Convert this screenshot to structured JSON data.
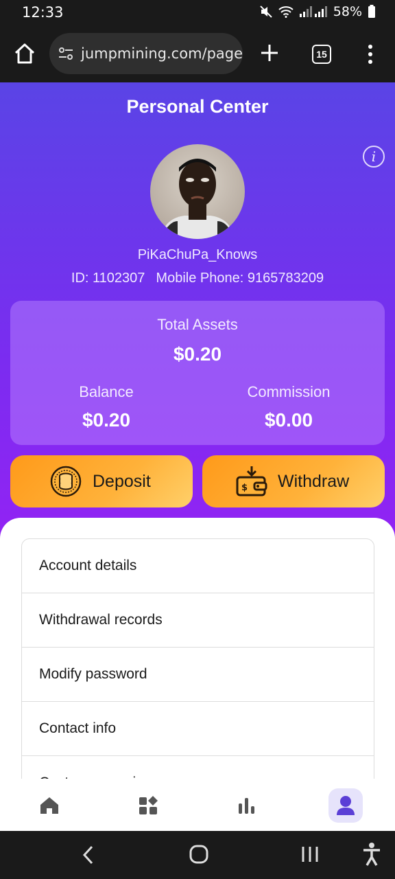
{
  "status": {
    "time": "12:33",
    "battery": "58%"
  },
  "browser": {
    "url": "jumpmining.com/pages",
    "tab_count": "15"
  },
  "page": {
    "title": "Personal Center"
  },
  "user": {
    "name": "PiKaChuPa_Knows",
    "id_text": "ID: 1102307",
    "phone_text": "Mobile Phone: 9165783209"
  },
  "assets": {
    "total_label": "Total Assets",
    "total_value": "$0.20",
    "balance_label": "Balance",
    "balance_value": "$0.20",
    "commission_label": "Commission",
    "commission_value": "$0.00"
  },
  "actions": {
    "deposit_label": "Deposit",
    "withdraw_label": "Withdraw"
  },
  "menu": {
    "items": [
      {
        "label": "Account details"
      },
      {
        "label": "Withdrawal records"
      },
      {
        "label": "Modify password"
      },
      {
        "label": "Contact info"
      },
      {
        "label": "Customer service"
      }
    ]
  },
  "nav": {
    "items": [
      "home-icon",
      "apps-icon",
      "chart-icon",
      "user-icon"
    ],
    "active": "user-icon"
  },
  "colors": {
    "accent": "#7b2cf0",
    "button": "#ffa726",
    "nav_active_bg": "#e6e3fb"
  }
}
